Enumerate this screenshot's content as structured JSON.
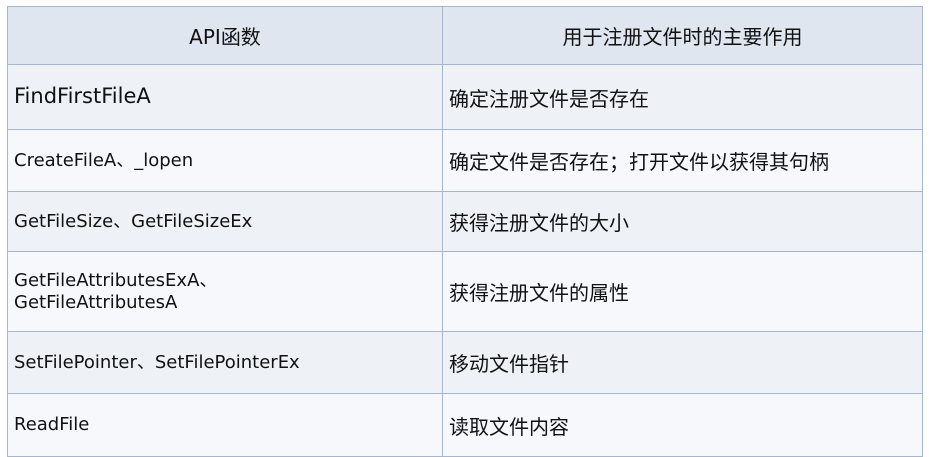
{
  "table": {
    "header": {
      "col1": "API函数",
      "col2": "用于注册文件时的主要作用"
    },
    "rows": [
      {
        "name_lines": [
          "FindFirstFileA"
        ],
        "desc": "确定注册文件是否存在"
      },
      {
        "name_lines": [
          "CreateFileA、_lopen"
        ],
        "desc": "确定文件是否存在；打开文件以获得其句柄"
      },
      {
        "name_lines": [
          "GetFileSize、GetFileSizeEx"
        ],
        "desc": "获得注册文件的大小"
      },
      {
        "name_lines": [
          "GetFileAttributesExA、",
          "GetFileAttributesA"
        ],
        "desc": "获得注册文件的属性"
      },
      {
        "name_lines": [
          "SetFilePointer、SetFilePointerEx"
        ],
        "desc": "移动文件指针"
      },
      {
        "name_lines": [
          "ReadFile"
        ],
        "desc": "读取文件内容"
      }
    ]
  },
  "colors": {
    "header_bg": "#dfe6f0",
    "row_odd_bg": "#eef1f5",
    "row_even_bg": "#f7f8fb",
    "border": "#a7b6cc"
  }
}
